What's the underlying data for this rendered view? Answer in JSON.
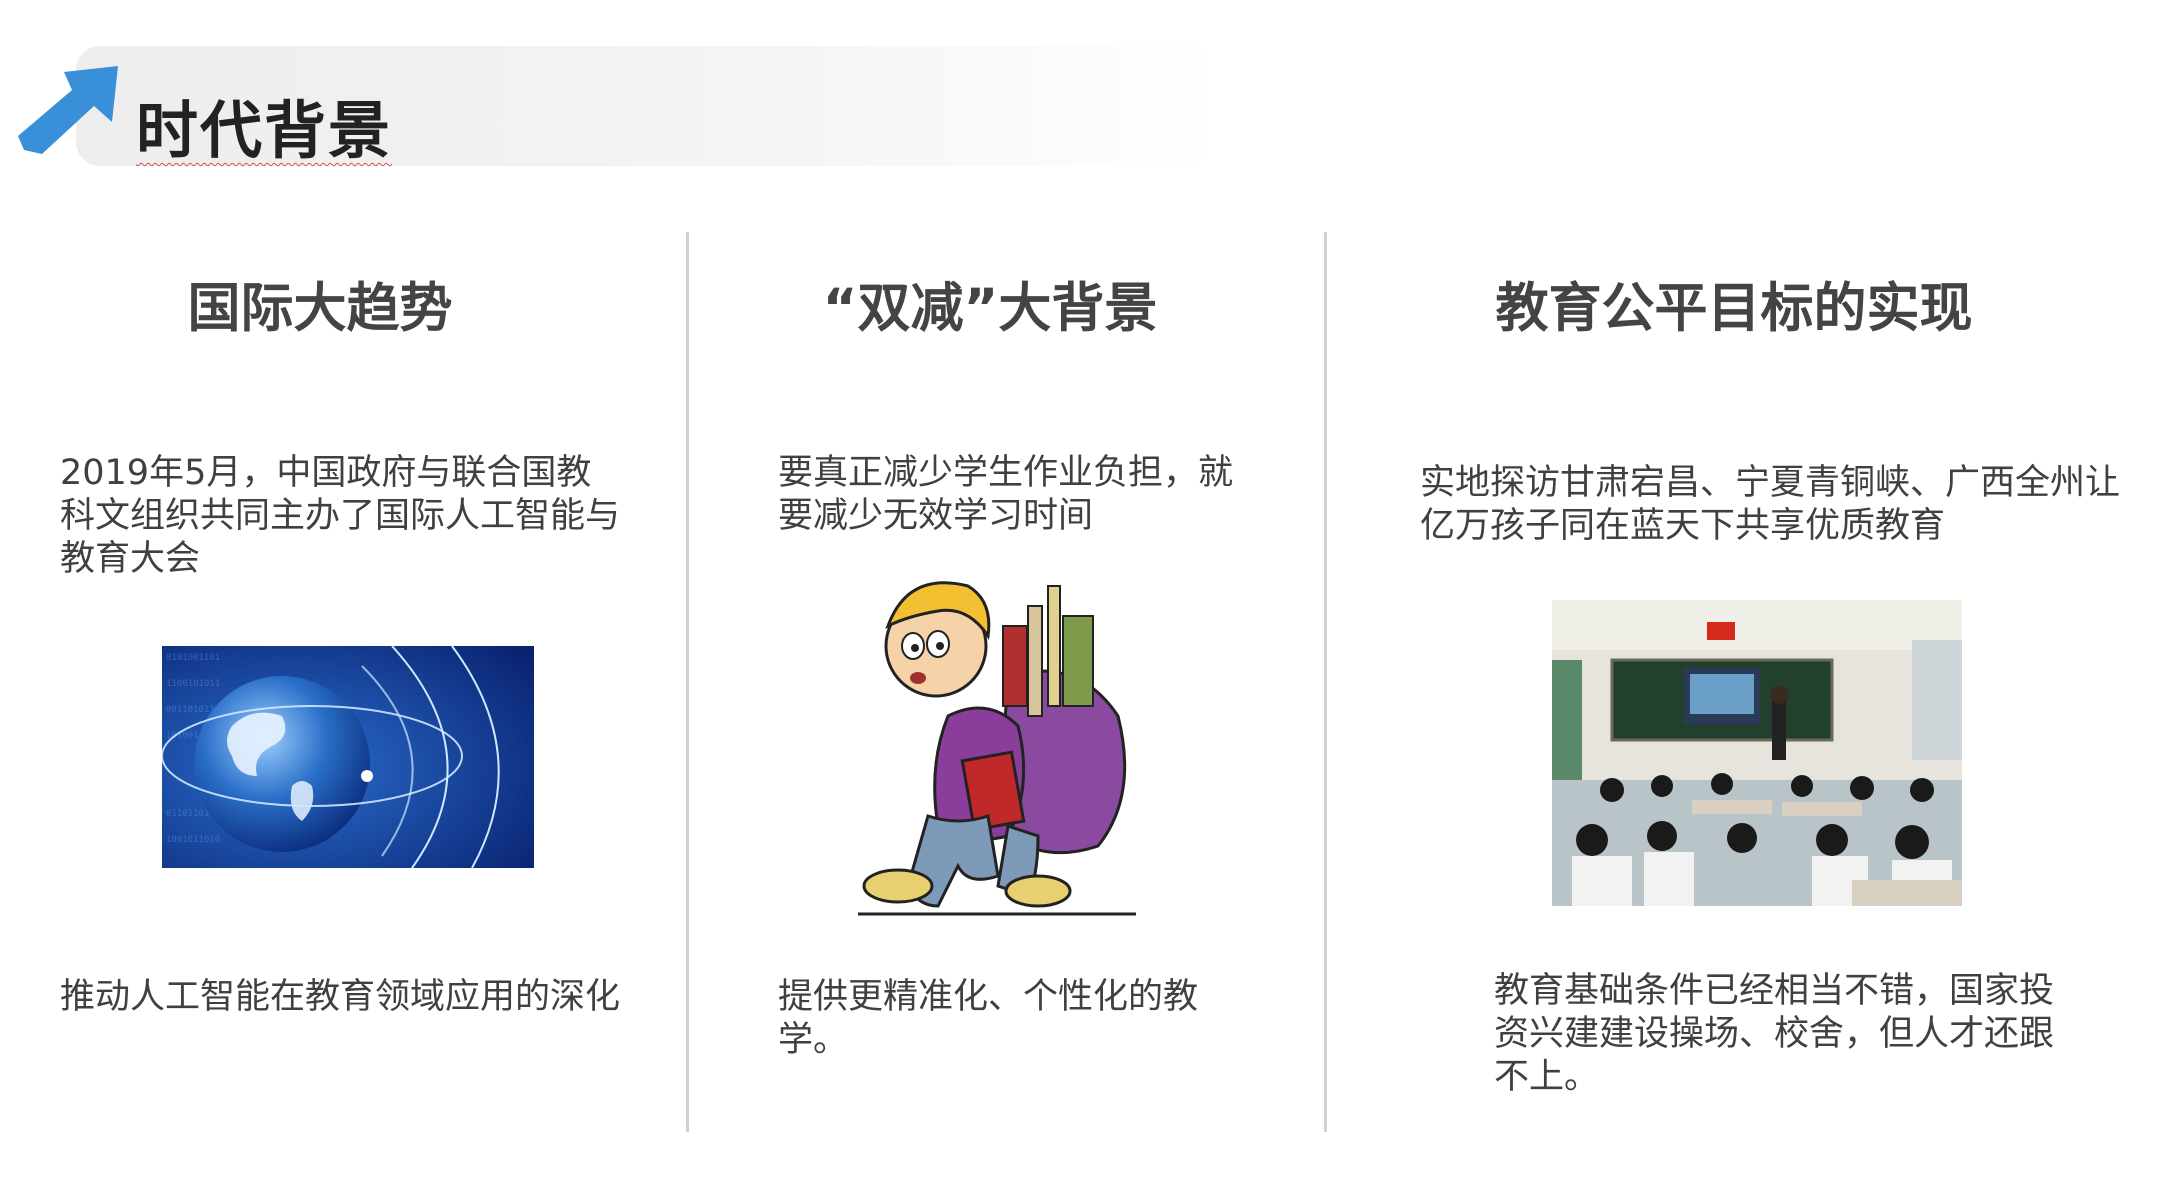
{
  "header": {
    "title": "时代背景",
    "arrow_icon": "arrow-up-right-icon"
  },
  "columns": [
    {
      "title": "国际大趋势",
      "intro": "2019年5月，中国政府与联合国教科文组织共同主办了国际人工智能与教育大会",
      "image": "globe-network-image",
      "conclusion": "推动人工智能在教育领域应用的深化"
    },
    {
      "title": "“双减”大背景",
      "intro": "要真正减少学生作业负担，就要减少无效学习时间",
      "image": "student-heavy-backpack-image",
      "conclusion": "提供更精准化、个性化的教学。"
    },
    {
      "title": "教育公平目标的实现",
      "intro": "实地探访甘肃宕昌、宁夏青铜峡、广西全州让亿万孩子同在蓝天下共享优质教育",
      "image": "classroom-photo-image",
      "conclusion": "教育基础条件已经相当不错，国家投资兴建建设操场、校舍，但人才还跟不上。"
    }
  ],
  "colors": {
    "arrow": "#3a8fd9",
    "divider": "#d0d0d0",
    "text": "#404040"
  }
}
